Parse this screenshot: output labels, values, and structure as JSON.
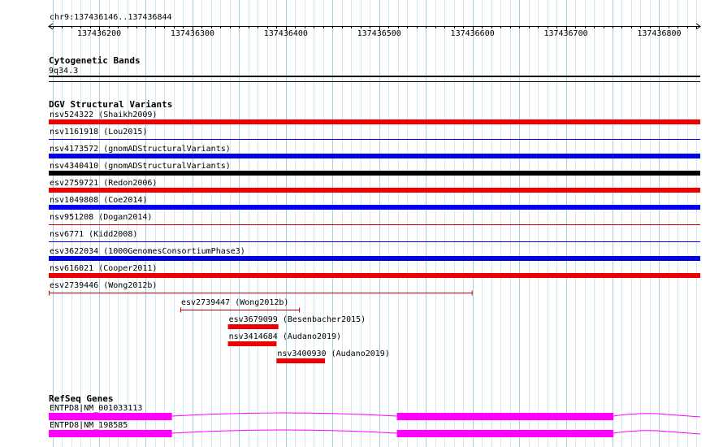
{
  "locus": "chr9:137436146..137436844",
  "ruler": {
    "start": 137436146,
    "end": 137436844,
    "ticks": [
      "137436200",
      "137436300",
      "137436400",
      "137436500",
      "137436600",
      "137436700",
      "137436800"
    ]
  },
  "tracks": {
    "cytoband": {
      "title": "Cytogenetic Bands",
      "band": "9q34.3"
    },
    "dgv": {
      "title": "DGV Structural Variants",
      "variants": [
        {
          "label": "nsv524322 (Shaikh2009)",
          "start": 137436146,
          "end": 137436844,
          "style": "thick",
          "color": "#ee0000"
        },
        {
          "label": "nsv1161918 (Lou2015)",
          "start": 137436146,
          "end": 137436844,
          "style": "thin",
          "color": "#0000ee"
        },
        {
          "label": "nsv4173572 (gnomADStructuralVariants)",
          "start": 137436146,
          "end": 137436844,
          "style": "thick",
          "color": "#0000ee"
        },
        {
          "label": "nsv4340410 (gnomADStructuralVariants)",
          "start": 137436146,
          "end": 137436844,
          "style": "thick",
          "color": "#000000"
        },
        {
          "label": "esv2759721 (Redon2006)",
          "start": 137436146,
          "end": 137436844,
          "style": "thick",
          "color": "#ee0000"
        },
        {
          "label": "nsv1049808 (Coe2014)",
          "start": 137436146,
          "end": 137436844,
          "style": "thick",
          "color": "#0000ee"
        },
        {
          "label": "nsv951208 (Dogan2014)",
          "start": 137436146,
          "end": 137436844,
          "style": "thin",
          "color": "#cc0000"
        },
        {
          "label": "nsv6771 (Kidd2008)",
          "start": 137436146,
          "end": 137436844,
          "style": "thin",
          "color": "#0000ee"
        },
        {
          "label": "esv3622034 (1000GenomesConsortiumPhase3)",
          "start": 137436146,
          "end": 137436844,
          "style": "thick",
          "color": "#0000ee"
        },
        {
          "label": "nsv616021 (Cooper2011)",
          "start": 137436146,
          "end": 137436844,
          "style": "thick",
          "color": "#ee0000"
        },
        {
          "label": "esv2739446 (Wong2012b)",
          "start": 137436146,
          "end": 137436600,
          "style": "thin-capped",
          "color": "#cc0000"
        },
        {
          "label": "esv2739447 (Wong2012b)",
          "start": 137436287,
          "end": 137436415,
          "style": "thin-capped",
          "color": "#cc0000"
        },
        {
          "label": "esv3679099 (Besenbacher2015)",
          "start": 137436338,
          "end": 137436392,
          "style": "thick",
          "color": "#ee0000"
        },
        {
          "label": "nsv3414684 (Audano2019)",
          "start": 137436338,
          "end": 137436390,
          "style": "thick",
          "color": "#ee0000"
        },
        {
          "label": "nsv3400930 (Audano2019)",
          "start": 137436390,
          "end": 137436442,
          "style": "thick",
          "color": "#ee0000"
        }
      ]
    },
    "refseq": {
      "title": "RefSeq Genes",
      "genes": [
        {
          "label": "ENTPD8|NM_001033113",
          "exons": [
            [
              137436146,
              137436278
            ],
            [
              137436519,
              137436751
            ]
          ],
          "color": "#ff00ff"
        },
        {
          "label": "ENTPD8|NM_198585",
          "exons": [
            [
              137436146,
              137436278
            ],
            [
              137436519,
              137436751
            ]
          ],
          "color": "#ff00ff"
        }
      ]
    }
  },
  "colors": {
    "grid": "#aaddee",
    "exon": "#ff00ff"
  }
}
